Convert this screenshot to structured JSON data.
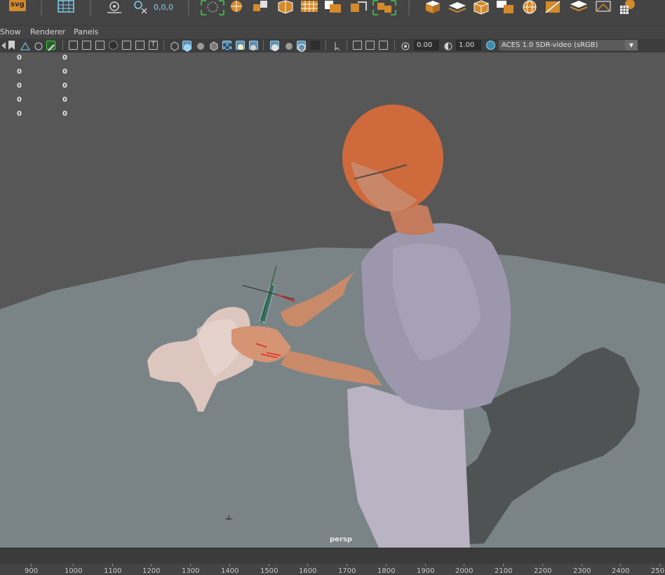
{
  "shelf": {
    "svg_label": "svg",
    "snap_coords": "0,0,0"
  },
  "menubar": {
    "items": [
      "Show",
      "Renderer",
      "Panels"
    ]
  },
  "toolbar": {
    "exposure_value": "0.00",
    "gamma_value": "1.00",
    "color_space": "ACES 1.0 SDR-video (sRGB)"
  },
  "viewport": {
    "camera_label": "persp",
    "hud_rows": [
      {
        "a": "0",
        "b": "0"
      },
      {
        "a": "0",
        "b": "0"
      },
      {
        "a": "0",
        "b": "0"
      },
      {
        "a": "0",
        "b": "0"
      },
      {
        "a": "0",
        "b": "0"
      }
    ]
  },
  "timeline": {
    "ticks": [
      "900",
      "1000",
      "1100",
      "1200",
      "1300",
      "1400",
      "1500",
      "1600",
      "1700",
      "1800",
      "1900",
      "2000",
      "2100",
      "2200",
      "2300",
      "2400",
      "250"
    ]
  },
  "colors": {
    "accent": "#d38a2c",
    "highlight": "#5c8fb3",
    "ground": "#7a8486",
    "background": "#575757"
  }
}
